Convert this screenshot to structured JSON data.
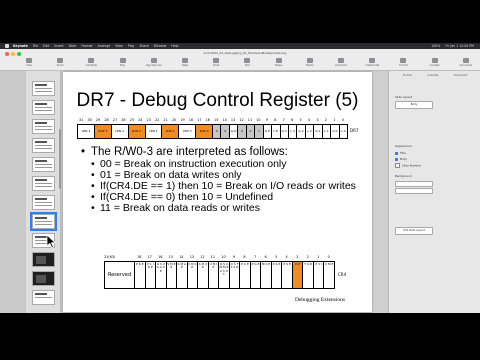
{
  "menubar": {
    "app_name": "Keynote",
    "items": [
      "File",
      "Edit",
      "Insert",
      "Slide",
      "Format",
      "Arrange",
      "View",
      "Play",
      "Share",
      "Window",
      "Help"
    ],
    "right": [
      "100%",
      "Fri Jan 1 12:00 PM"
    ]
  },
  "window": {
    "doc_title": "Arch1001_02_Debugging_01_HardwareBreakpoints.key"
  },
  "toolbar": {
    "tools": [
      "View",
      "Zoom",
      "Add Slide",
      "Play",
      "Keynote Live",
      "Table",
      "Chart",
      "Text",
      "Shape",
      "Media",
      "Comment",
      "Collaborate",
      "Format",
      "Animate",
      "Document"
    ]
  },
  "slide": {
    "title": "DR7 - Debug Control Register (5)",
    "dr7": {
      "bit_numbers": [
        "31",
        "30",
        "29",
        "28",
        "27",
        "26",
        "25",
        "24",
        "23",
        "22",
        "21",
        "20",
        "19",
        "18",
        "17",
        "16",
        "15",
        "14",
        "13",
        "12",
        "11",
        "10",
        "9",
        "8",
        "7",
        "6",
        "5",
        "4",
        "3",
        "2",
        "1",
        "0"
      ],
      "cells": [
        "LEN 3",
        "R/W 3",
        "LEN 2",
        "R/W 2",
        "LEN 1",
        "R/W 1",
        "LEN 0",
        "R/W 0",
        "0",
        "0",
        "G D",
        "0",
        "0",
        "1",
        "G E",
        "L E",
        "G 3",
        "L 3",
        "G 2",
        "L 2",
        "G 1",
        "L 1",
        "G 0",
        "L 0"
      ],
      "label": "DR7"
    },
    "bullets": [
      {
        "level": 1,
        "text": "The R/W0-3 are interpreted as follows:"
      },
      {
        "level": 2,
        "text": "00 = Break on instruction execution only"
      },
      {
        "level": 2,
        "text": "01 = Break on data writes only"
      },
      {
        "level": 2,
        "text": "If(CR4.DE == 1) then 10 = Break on I/O reads or writes"
      },
      {
        "level": 2,
        "text": "If(CR4.DE == 0) then 10 = Undefined"
      },
      {
        "level": 2,
        "text": "11 = Break on data reads or writes"
      }
    ],
    "cr4": {
      "bit_numbers": [
        "31(63)",
        "18",
        "17",
        "16",
        "15",
        "14",
        "13",
        "12",
        "11",
        "10",
        "9",
        "8",
        "7",
        "6",
        "5",
        "4",
        "3",
        "2",
        "1",
        "0"
      ],
      "cells": [
        "Reserved",
        "P K E",
        "P C I D E",
        "O S X S A V E",
        "S M E P",
        "S M A P",
        "V M X E",
        "S M X E",
        "U M I P",
        "O S X M M E X C P T",
        "O S F X S R",
        "P C E",
        "P G E",
        "M C E",
        "P A E",
        "P S E",
        "D E",
        "T S D",
        "P V I",
        "V M E"
      ],
      "label": "CR4"
    },
    "footnote": "Debugging Extensions"
  },
  "inspector": {
    "tabs": [
      "Format",
      "Animate",
      "Document"
    ],
    "layout_label": "Slide Layout",
    "layout_value": "Body",
    "appearance_label": "Appearance",
    "options": [
      "Title",
      "Body",
      "Slide Number"
    ],
    "background_label": "Background",
    "edit_button": "Edit Slide Layout"
  },
  "colors": {
    "accent_orange": "#f08c24",
    "grey_cell": "#c6c6c6",
    "selection_blue": "#2d7ff9"
  }
}
